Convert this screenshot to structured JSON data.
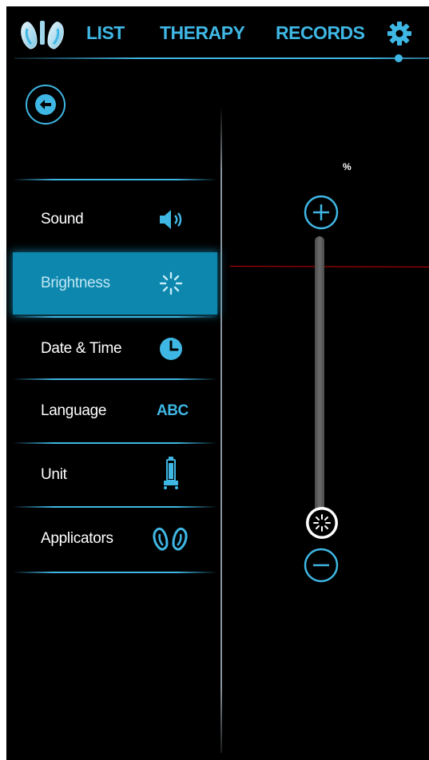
{
  "nav": {
    "tabs": [
      {
        "label": "LIST"
      },
      {
        "label": "THERAPY"
      },
      {
        "label": "RECORDS"
      }
    ],
    "settings_icon": "gear-icon",
    "active": "settings"
  },
  "back_icon": "arrow-left-icon",
  "menu": {
    "items": [
      {
        "label": "Sound",
        "icon": "speaker-icon"
      },
      {
        "label": "Brightness",
        "icon": "brightness-icon",
        "selected": true
      },
      {
        "label": "Date & Time",
        "icon": "clock-icon"
      },
      {
        "label": "Language",
        "icon_text": "ABC"
      },
      {
        "label": "Unit",
        "icon": "device-unit-icon"
      },
      {
        "label": "Applicators",
        "icon": "applicators-icon"
      }
    ]
  },
  "brightness": {
    "unit": "%",
    "level": 0
  },
  "colors": {
    "accent": "#3fb7e4",
    "selected_bg": "#0d87ad",
    "background": "#000000"
  }
}
